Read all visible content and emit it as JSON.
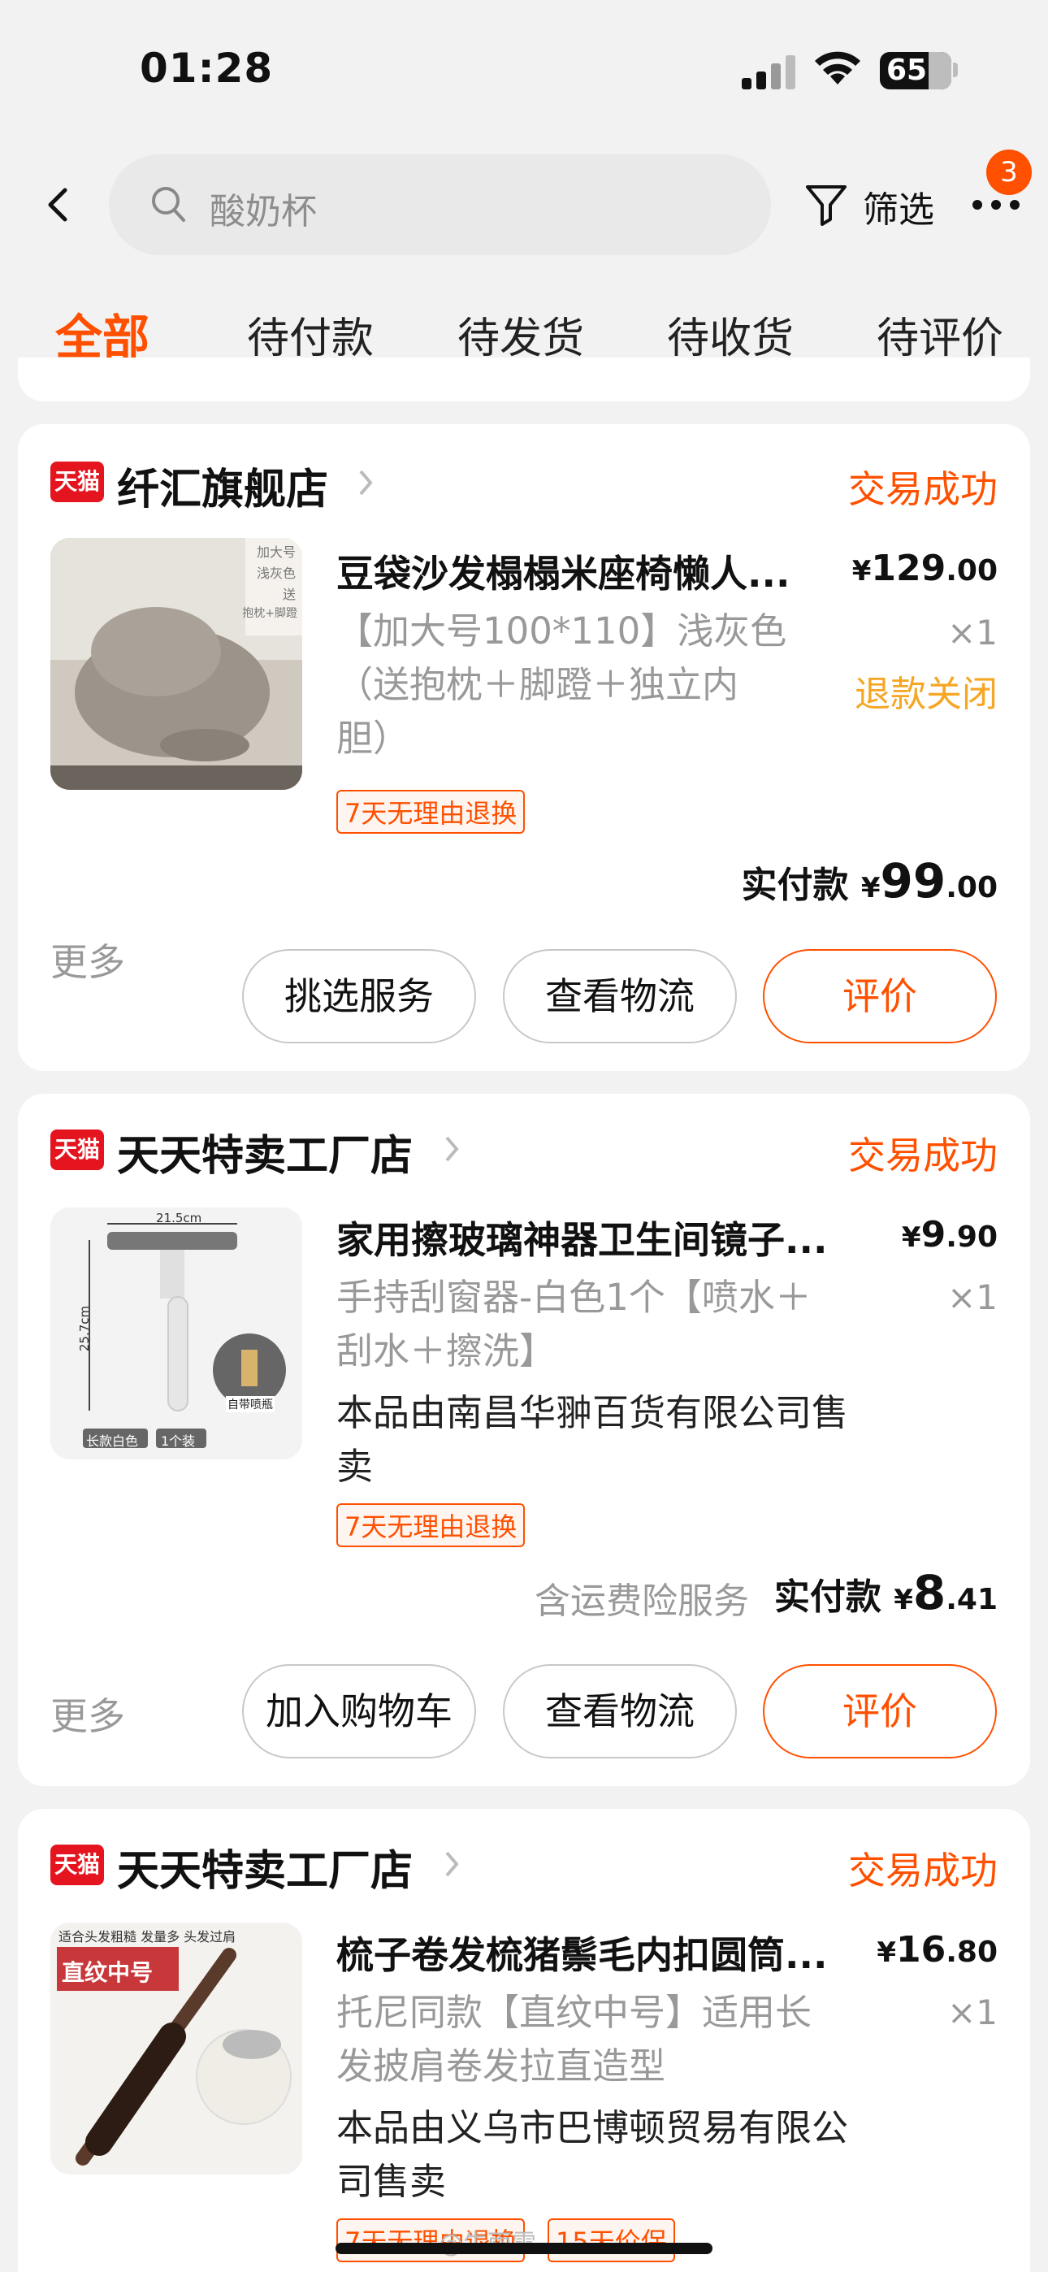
{
  "status_bar": {
    "time": "01:28",
    "battery": "65"
  },
  "search": {
    "query": "酸奶杯",
    "filter_label": "筛选",
    "notification_count": "3"
  },
  "tabs": [
    {
      "label": "全部",
      "active": true
    },
    {
      "label": "待付款"
    },
    {
      "label": "待发货"
    },
    {
      "label": "待收货"
    },
    {
      "label": "待评价"
    }
  ],
  "orders": [
    {
      "store_badge": "天猫",
      "shop": "纤汇旗舰店",
      "status": "交易成功",
      "title": "豆袋沙发榻榻米座椅懒人...",
      "spec": "【加大号100*110】浅灰色（送抱枕＋脚蹬＋独立内胆）",
      "price_currency": "¥",
      "price_int": "129",
      "price_dec": ".00",
      "qty": "×1",
      "refund_status": "退款关闭",
      "tag": "7天无理由退换",
      "paid_label": "实付款",
      "paid_currency": "¥",
      "paid_int": "99",
      "paid_dec": ".00",
      "more": "更多",
      "buttons": [
        "挑选服务",
        "查看物流",
        "评价"
      ]
    },
    {
      "store_badge": "天猫",
      "shop": "天天特卖工厂店",
      "status": "交易成功",
      "title": "家用擦玻璃神器卫生间镜子...",
      "spec": "手持刮窗器-白色1个【喷水＋刮水＋擦洗】",
      "seller": "本品由南昌华翀百货有限公司售卖",
      "price_currency": "¥",
      "price_int": "9",
      "price_dec": ".90",
      "qty": "×1",
      "tag": "7天无理由退换",
      "insurance": "含运费险服务",
      "paid_label": "实付款",
      "paid_currency": "¥",
      "paid_int": "8",
      "paid_dec": ".41",
      "more": "更多",
      "buttons": [
        "加入购物车",
        "查看物流",
        "评价"
      ],
      "thumb_labels": [
        "21.5cm",
        "25.7cm",
        "长款白色",
        "1个装",
        "自带喷瓶"
      ]
    },
    {
      "store_badge": "天猫",
      "shop": "天天特卖工厂店",
      "status": "交易成功",
      "title": "梳子卷发梳猪鬃毛内扣圆筒...",
      "spec": "托尼同款【直纹中号】适用长发披肩卷发拉直造型",
      "seller": "本品由义乌市巴博顿贸易有限公司售卖",
      "price_currency": "¥",
      "price_int": "16",
      "price_dec": ".80",
      "qty": "×1",
      "tags": [
        "7天无理由退换",
        "15天价保"
      ],
      "thumb_labels": [
        "适合头发粗糙 发量多 头发过肩",
        "直纹中号"
      ]
    }
  ],
  "thumb1_labels": [
    "加大号",
    "浅灰色",
    "送",
    "抱枕+脚蹬"
  ],
  "watermark": "@牛雨雪"
}
